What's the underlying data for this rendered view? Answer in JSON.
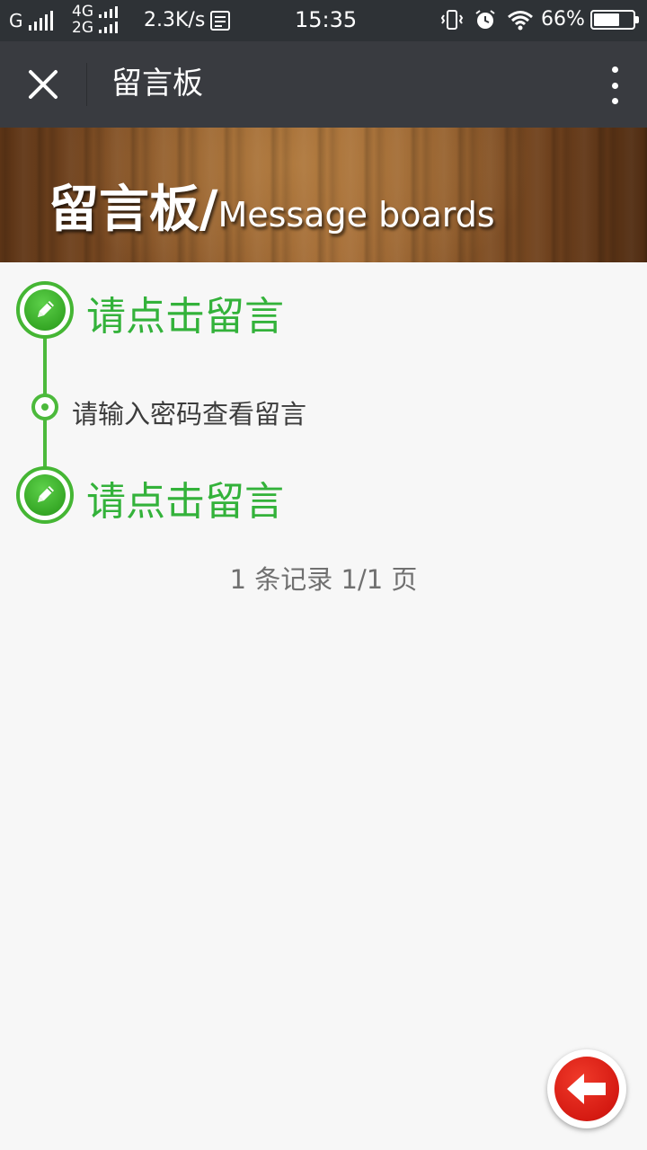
{
  "status_bar": {
    "carrier1": "G",
    "net_top": "4G",
    "net_bottom": "2G",
    "speed": "2.3K/s",
    "time": "15:35",
    "battery": "66%",
    "battery_level": 0.66
  },
  "title_bar": {
    "title": "留言板",
    "close_icon": "close-icon",
    "more_icon": "more-vertical-icon"
  },
  "banner": {
    "title_cn": "留言板/",
    "title_en": "Message boards"
  },
  "timeline": {
    "post_link_top": "请点击留言",
    "message_placeholder": "请输入密码查看留言",
    "post_link_bottom": "请点击留言",
    "pen_icon": "pencil-icon"
  },
  "pagination": {
    "summary": "1 条记录 1/1 页"
  },
  "floating": {
    "back_icon": "arrow-left-icon"
  },
  "colors": {
    "accent_green": "#33b23a",
    "back_red": "#d51a12",
    "titlebar": "#393b40",
    "statusbar": "#2e3236"
  }
}
